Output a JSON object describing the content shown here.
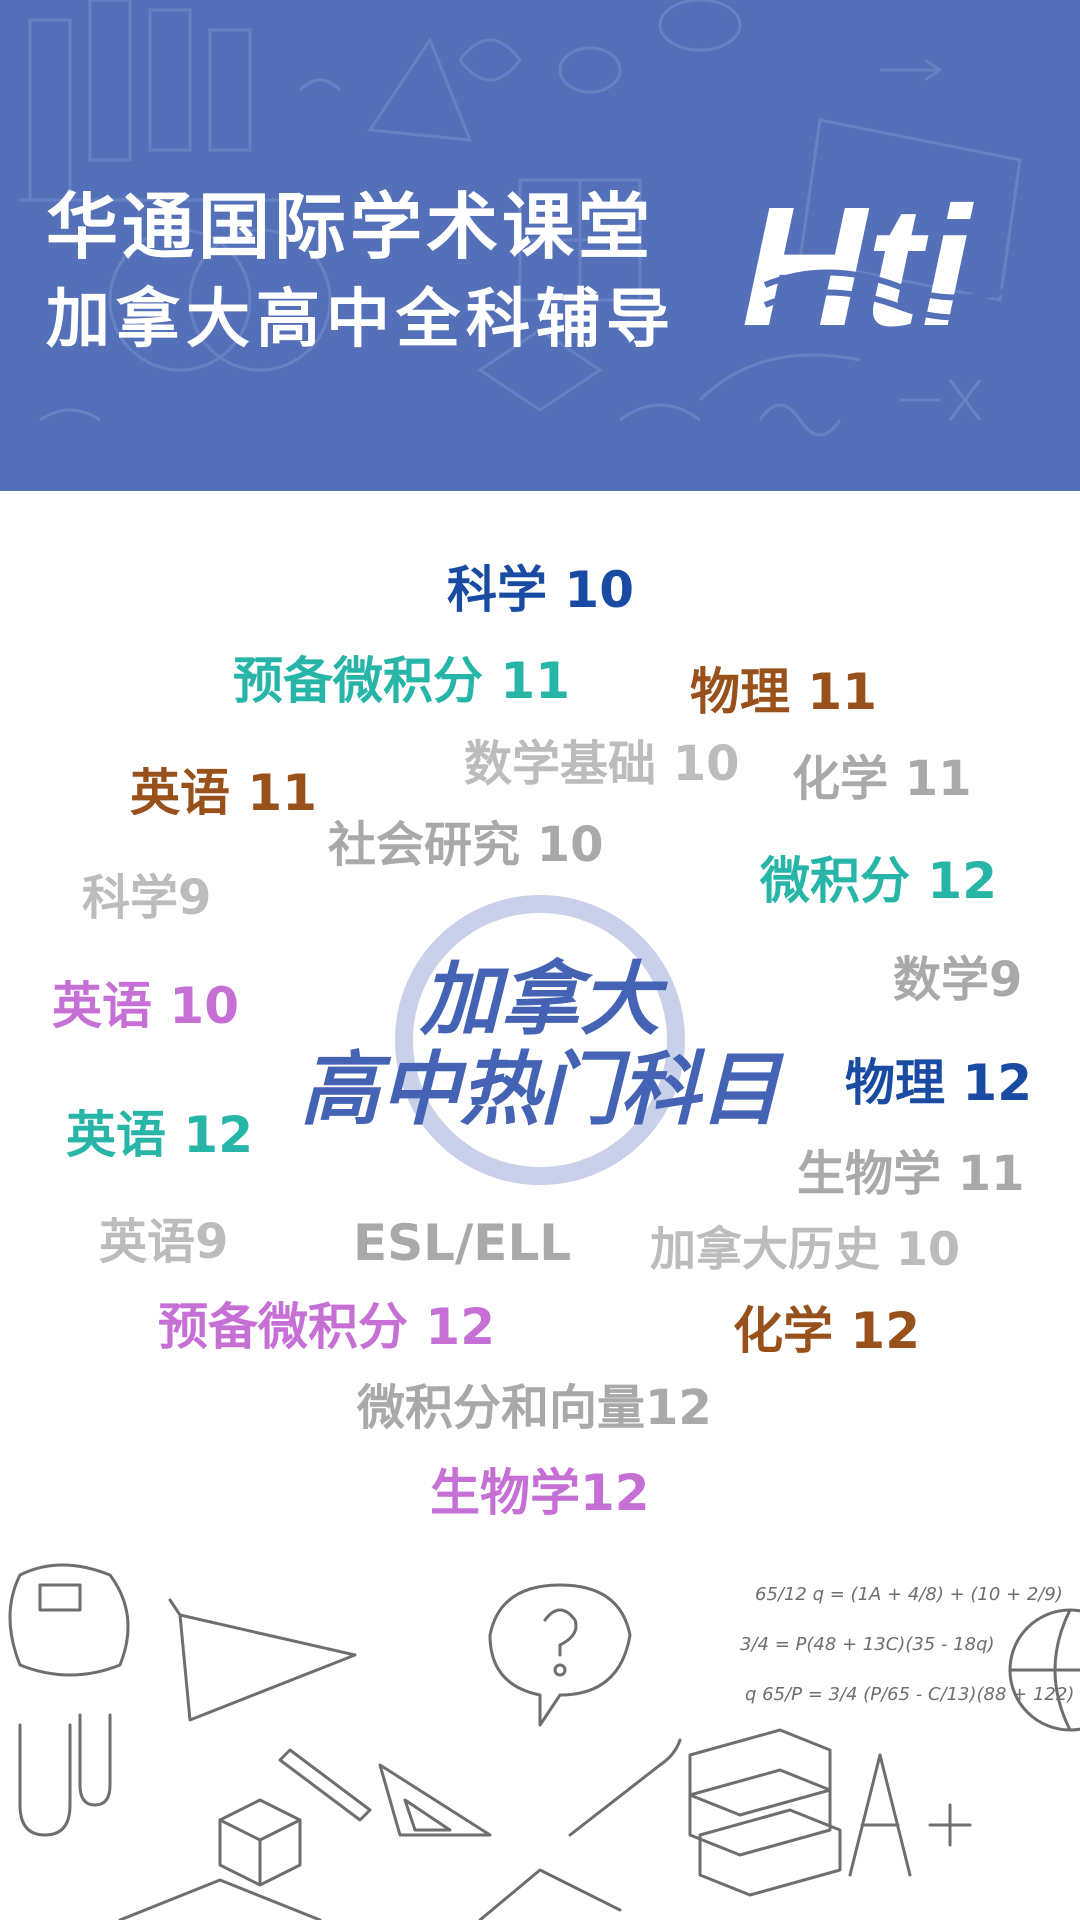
{
  "header": {
    "title": "华通国际学术课堂",
    "subtitle": "加拿大高中全科辅导",
    "logo_text": "Hti",
    "background_color": "#5470b8"
  },
  "center": {
    "line1": "加拿大",
    "line2": "高中热门科目",
    "color": "#4563b4"
  },
  "subjects": [
    {
      "label": "科学 10",
      "color": "#1a4ba3"
    },
    {
      "label": "预备微积分 11",
      "color": "#27b5a8"
    },
    {
      "label": "物理 11",
      "color": "#99511c"
    },
    {
      "label": "数学基础 10",
      "color": "#bcbcbc"
    },
    {
      "label": "英语 11",
      "color": "#99511c"
    },
    {
      "label": "化学 11",
      "color": "#a9a9a9"
    },
    {
      "label": "社会研究 10",
      "color": "#a9a9a9"
    },
    {
      "label": "微积分 12",
      "color": "#27b5a8"
    },
    {
      "label": "科学9",
      "color": "#bcbcbc"
    },
    {
      "label": "数学9",
      "color": "#a9a9a9"
    },
    {
      "label": "英语 10",
      "color": "#c670d6"
    },
    {
      "label": "物理 12",
      "color": "#1a4ba3"
    },
    {
      "label": "英语 12",
      "color": "#27b5a8"
    },
    {
      "label": "生物学 11",
      "color": "#a9a9a9"
    },
    {
      "label": "英语9",
      "color": "#bcbcbc"
    },
    {
      "label": "ESL/ELL",
      "color": "#a9a9a9"
    },
    {
      "label": "加拿大历史 10",
      "color": "#bcbcbc"
    },
    {
      "label": "预备微积分 12",
      "color": "#c670d6"
    },
    {
      "label": "化学 12",
      "color": "#99511c"
    },
    {
      "label": "微积分和向量12",
      "color": "#a9a9a9"
    },
    {
      "label": "生物学12",
      "color": "#c670d6"
    }
  ],
  "footer_sketch": {
    "formulas": [
      "65/12 q = (1A + 4/8) + (10 + 2/9)",
      "3/4 = P(48 + 13C)(35 - 18q)",
      "q 65/P = 3/4 (P/65 - C/13)(88 + 122)"
    ],
    "grade": "A+"
  }
}
